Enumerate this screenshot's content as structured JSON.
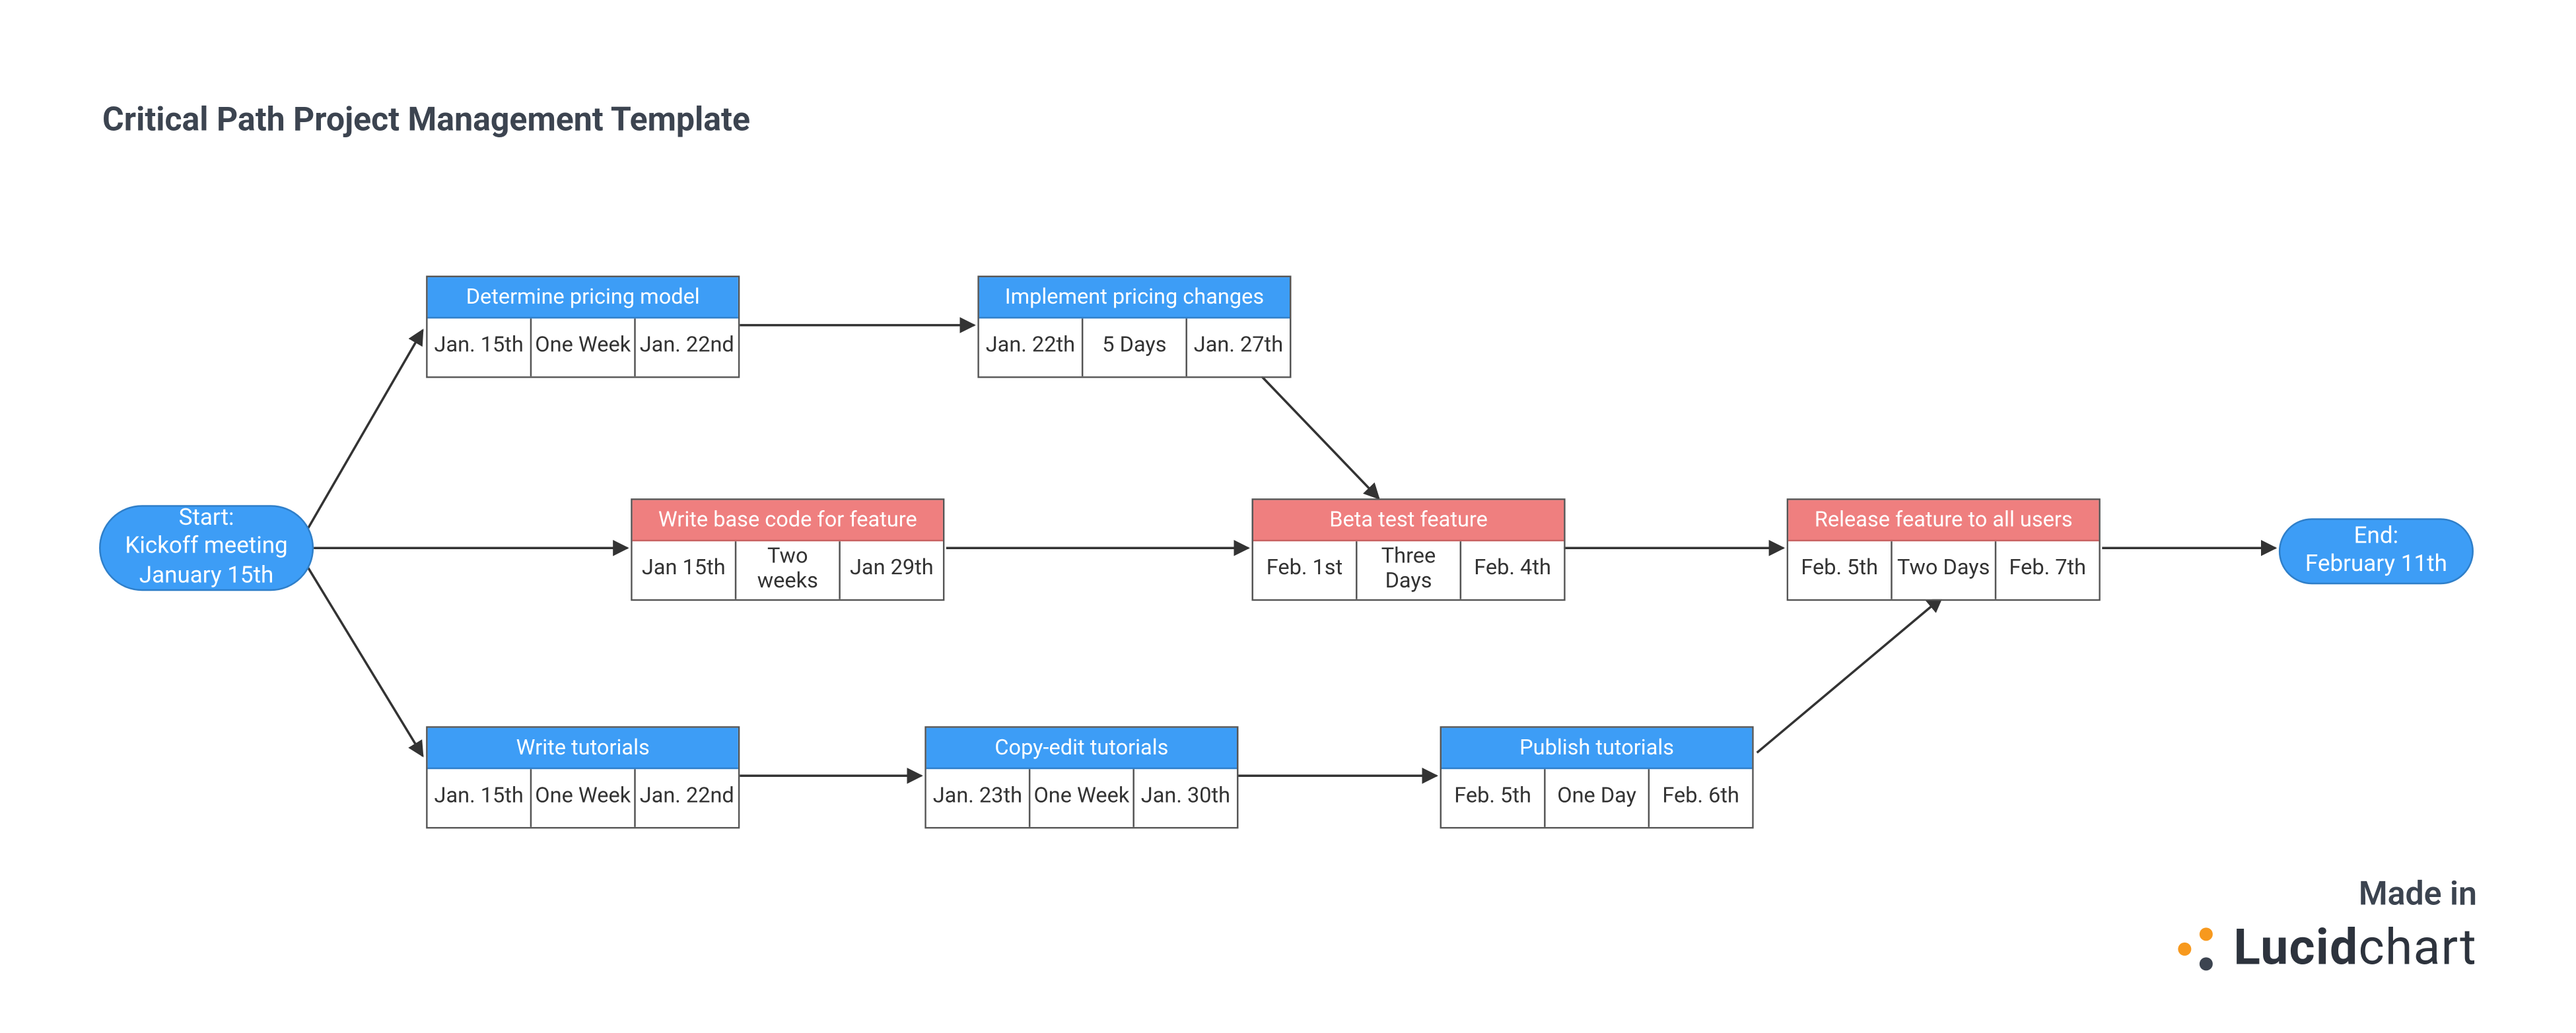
{
  "title": "Critical Path Project Management Template",
  "start": {
    "line1": "Start:",
    "line2": "Kickoff meeting",
    "line3": "January 15th"
  },
  "end": {
    "line1": "End:",
    "line2": "February 11th"
  },
  "tasks": {
    "pricingModel": {
      "label": "Determine pricing model",
      "start": "Jan. 15th",
      "dur": "One Week",
      "end": "Jan. 22nd",
      "color": "blue"
    },
    "pricingImpl": {
      "label": "Implement pricing changes",
      "start": "Jan. 22th",
      "dur": "5 Days",
      "end": "Jan. 27th",
      "color": "blue"
    },
    "baseCode": {
      "label": "Write base code for feature",
      "start": "Jan 15th",
      "dur": "Two weeks",
      "end": "Jan 29th",
      "color": "red"
    },
    "betaTest": {
      "label": "Beta test feature",
      "start": "Feb. 1st",
      "dur": "Three Days",
      "end": "Feb. 4th",
      "color": "red"
    },
    "release": {
      "label": "Release feature to all users",
      "start": "Feb. 5th",
      "dur": "Two Days",
      "end": "Feb. 7th",
      "color": "red"
    },
    "writeTut": {
      "label": "Write tutorials",
      "start": "Jan. 15th",
      "dur": "One Week",
      "end": "Jan. 22nd",
      "color": "blue"
    },
    "copyEdit": {
      "label": "Copy-edit tutorials",
      "start": "Jan. 23th",
      "dur": "One Week",
      "end": "Jan. 30th",
      "color": "blue"
    },
    "publish": {
      "label": "Publish tutorials",
      "start": "Feb. 5th",
      "dur": "One Day",
      "end": "Feb. 6th",
      "color": "blue"
    }
  },
  "footer": {
    "madeIn": "Made in",
    "brandBold": "Lucid",
    "brandLight": "chart"
  }
}
